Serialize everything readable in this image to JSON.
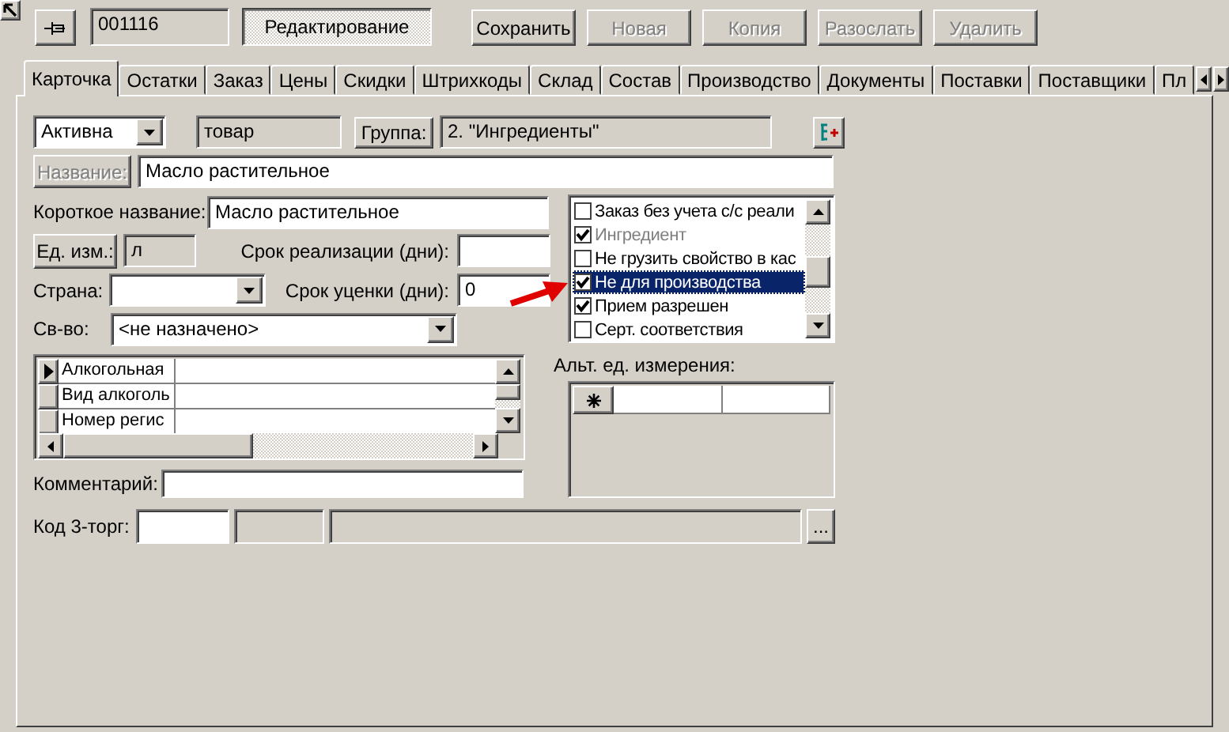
{
  "toolbar": {
    "code": "001116",
    "mode_button": {
      "label": "Редактирование",
      "pressed": true
    },
    "buttons": [
      {
        "label": "Сохранить",
        "disabled": false
      },
      {
        "label": "Новая",
        "disabled": true
      },
      {
        "label": "Копия",
        "disabled": true
      },
      {
        "label": "Разослать",
        "disabled": true
      },
      {
        "label": "Удалить",
        "disabled": true
      }
    ]
  },
  "tabs": [
    {
      "label": "Карточка",
      "selected": true
    },
    {
      "label": "Остатки",
      "selected": false
    },
    {
      "label": "Заказ",
      "selected": false
    },
    {
      "label": "Цены",
      "selected": false
    },
    {
      "label": "Скидки",
      "selected": false
    },
    {
      "label": "Штрихкоды",
      "selected": false
    },
    {
      "label": "Склад",
      "selected": false
    },
    {
      "label": "Состав",
      "selected": false
    },
    {
      "label": "Производство",
      "selected": false
    },
    {
      "label": "Документы",
      "selected": false
    },
    {
      "label": "Поставки",
      "selected": false
    },
    {
      "label": "Поставщики",
      "selected": false
    },
    {
      "label": "Пл",
      "selected": false
    }
  ],
  "form": {
    "status": "Активна",
    "type": "товар",
    "group_button": "Группа:",
    "group": "2. \"Ингредиенты\"",
    "name_button": {
      "label": "Название:",
      "disabled": true
    },
    "name": "Масло растительное",
    "short_name_label": "Короткое название:",
    "short_name": "Масло растительное",
    "unit_button": "Ед. изм.:",
    "unit": "л",
    "shelf_life_label": "Срок реализации (дни):",
    "country_label": "Страна:",
    "markdown_label": "Срок уценки (дни):",
    "markdown": "0",
    "property_label": "Св-во:",
    "property": "<не назначено>"
  },
  "flags": [
    {
      "label": "Заказ без учета с/с реали",
      "checked": false,
      "disabled": false,
      "selected": false
    },
    {
      "label": "Ингредиент",
      "checked": true,
      "disabled": true,
      "selected": false
    },
    {
      "label": "Не грузить свойство в кас",
      "checked": false,
      "disabled": false,
      "selected": false
    },
    {
      "label": "Не для производства",
      "checked": true,
      "disabled": false,
      "selected": true
    },
    {
      "label": "Прием разрешен",
      "checked": true,
      "disabled": false,
      "selected": false
    },
    {
      "label": "Серт. соответствия",
      "checked": false,
      "disabled": false,
      "selected": false
    }
  ],
  "properties_grid": {
    "rows": [
      {
        "name": "Алкогольная",
        "selected": true
      },
      {
        "name": "Вид алкоголь",
        "selected": false
      },
      {
        "name": "Номер регис",
        "selected": false
      }
    ]
  },
  "alt_units": {
    "label": "Альт. ед. измерения:"
  },
  "comment_label": "Комментарий:",
  "code_3torg": {
    "label": "Код 3-торг:",
    "browse_button": "..."
  }
}
